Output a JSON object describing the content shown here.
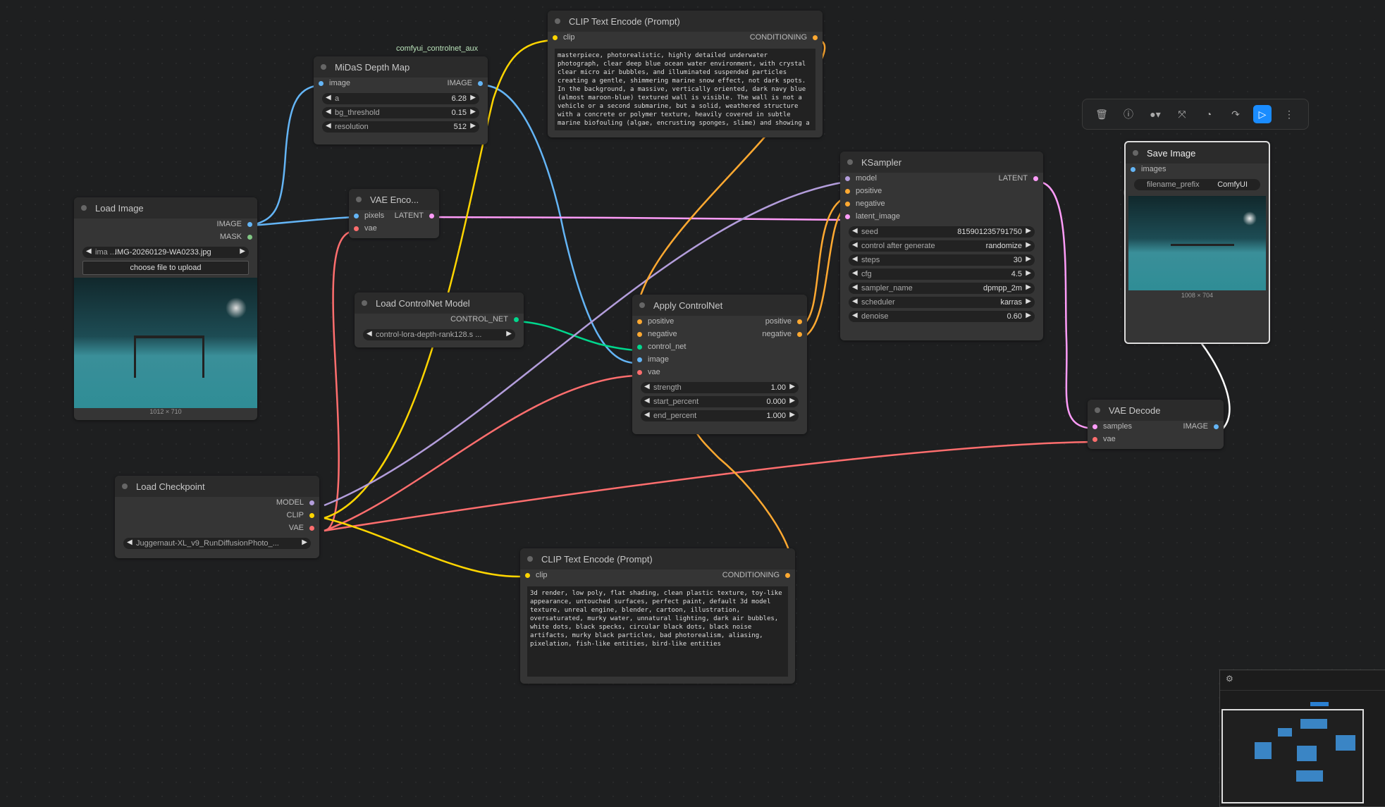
{
  "colors": {
    "image": "#64b5f6",
    "latent": "#ff9cf9",
    "vae": "#ff6e6e",
    "clip": "#ffd500",
    "conditioning": "#ffa931",
    "control_net": "#00d78d",
    "model": "#b39ddb",
    "accent": "#1a8cff"
  },
  "group_label": "comfyui_controlnet_aux",
  "load_image": {
    "title": "Load Image",
    "out_image": "IMAGE",
    "out_mask": "MASK",
    "image_label": "ima ...",
    "image_value": "IMG-20260129-WA0233.jpg",
    "upload_label": "choose file to upload",
    "dims": "1012 × 710"
  },
  "midas": {
    "title": "MiDaS Depth Map",
    "in_image": "image",
    "out_image": "IMAGE",
    "a_label": "a",
    "a_value": "6.28",
    "bg_label": "bg_threshold",
    "bg_value": "0.15",
    "res_label": "resolution",
    "res_value": "512"
  },
  "vae_encode": {
    "title": "VAE Enco...",
    "in_pixels": "pixels",
    "in_vae": "vae",
    "out_latent": "LATENT"
  },
  "clip_pos": {
    "title": "CLIP Text Encode (Prompt)",
    "in_clip": "clip",
    "out_cond": "CONDITIONING",
    "text": "masterpiece, photorealistic, highly detailed underwater photograph, clear deep blue ocean water environment, with crystal clear micro air bubbles, and illuminated suspended particles creating a gentle, shimmering marine snow effect, not dark spots. In the background, a massive, vertically oriented, dark navy blue (almost maroon-blue) textured wall is visible. The wall is not a vehicle or a second submarine, but a solid, weathered structure with a concrete or polymer texture, heavily covered in subtle marine biofouling (algae, encrusting sponges, slime) and showing a"
  },
  "controlnet_loader": {
    "title": "Load ControlNet Model",
    "out": "CONTROL_NET",
    "model_value": "control-lora-depth-rank128.s ..."
  },
  "apply_cn": {
    "title": "Apply ControlNet",
    "in_positive": "positive",
    "in_negative": "negative",
    "in_control": "control_net",
    "in_image": "image",
    "in_vae": "vae",
    "out_positive": "positive",
    "out_negative": "negative",
    "strength_label": "strength",
    "strength_value": "1.00",
    "start_label": "start_percent",
    "start_value": "0.000",
    "end_label": "end_percent",
    "end_value": "1.000"
  },
  "ksampler": {
    "title": "KSampler",
    "in_model": "model",
    "in_positive": "positive",
    "in_negative": "negative",
    "in_latent": "latent_image",
    "out_latent": "LATENT",
    "widgets": [
      {
        "label": "seed",
        "value": "815901235791750"
      },
      {
        "label": "control after generate",
        "value": "randomize"
      },
      {
        "label": "steps",
        "value": "30"
      },
      {
        "label": "cfg",
        "value": "4.5"
      },
      {
        "label": "sampler_name",
        "value": "dpmpp_2m"
      },
      {
        "label": "scheduler",
        "value": "karras"
      },
      {
        "label": "denoise",
        "value": "0.60"
      }
    ]
  },
  "save_image": {
    "title": "Save Image",
    "in_images": "images",
    "prefix_label": "filename_prefix",
    "prefix_value": "ComfyUI",
    "dims": "1008 × 704"
  },
  "vae_decode": {
    "title": "VAE Decode",
    "in_samples": "samples",
    "in_vae": "vae",
    "out_image": "IMAGE"
  },
  "checkpoint": {
    "title": "Load Checkpoint",
    "out_model": "MODEL",
    "out_clip": "CLIP",
    "out_vae": "VAE",
    "ckpt_value": "Juggernaut-XL_v9_RunDiffusionPhoto_..."
  },
  "clip_neg": {
    "title": "CLIP Text Encode (Prompt)",
    "in_clip": "clip",
    "out_cond": "CONDITIONING",
    "text": "3d render, low poly, flat shading, clean plastic texture, toy-like appearance, untouched surfaces, perfect paint, default 3d model texture, unreal engine, blender, cartoon, illustration, oversaturated, murky water, unnatural lighting, dark air bubbles, white dots, black specks, circular black dots, black noise artifacts, murky black particles, bad photorealism, aliasing, pixelation, fish-like entities, bird-like entities"
  }
}
